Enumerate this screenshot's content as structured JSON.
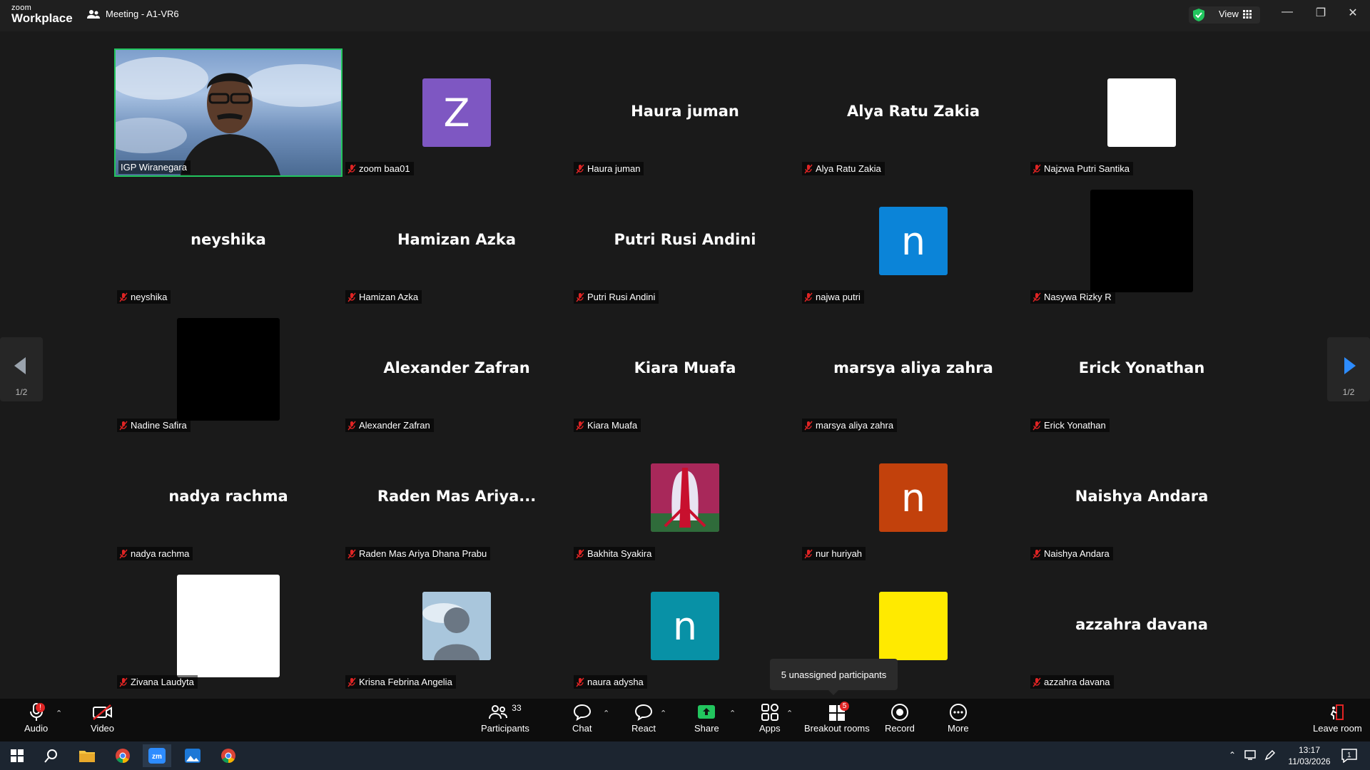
{
  "titlebar": {
    "logo_line1": "zoom",
    "logo_line2": "Workplace",
    "meeting_title": "Meeting - A1-VR6",
    "view_label": "View"
  },
  "colors": {
    "active_speaker_border": "#22c55e",
    "avatar_purple": "#7e57c2",
    "avatar_blue": "#0b84d8",
    "avatar_orange": "#c2410c",
    "avatar_teal": "#0891a6",
    "avatar_yellow": "#ffea00",
    "share_green": "#22c55e"
  },
  "participants": [
    {
      "label": "IGP Wiranegara",
      "type": "video"
    },
    {
      "label": "zoom baa01",
      "type": "avatar",
      "letter": "Z",
      "color": "#7e57c2"
    },
    {
      "label": "Haura juman",
      "type": "name",
      "display": "Haura juman"
    },
    {
      "label": "Alya Ratu Zakia",
      "type": "name",
      "display": "Alya Ratu Zakia"
    },
    {
      "label": "Najzwa Putri Santika",
      "type": "avatar",
      "letter": "",
      "color": "#ffffff"
    },
    {
      "label": "neyshika",
      "type": "name",
      "display": "neyshika"
    },
    {
      "label": "Hamizan Azka",
      "type": "name",
      "display": "Hamizan Azka"
    },
    {
      "label": "Putri Rusi Andini",
      "type": "name",
      "display": "Putri Rusi Andini"
    },
    {
      "label": "najwa putri",
      "type": "avatar",
      "letter": "n",
      "color": "#0b84d8"
    },
    {
      "label": "Nasywa Rizky R",
      "type": "bigbox",
      "color": "#000000"
    },
    {
      "label": "Nadine Safira",
      "type": "bigbox",
      "color": "#000000"
    },
    {
      "label": "Alexander Zafran",
      "type": "name",
      "display": "Alexander Zafran"
    },
    {
      "label": "Kiara Muafa",
      "type": "name",
      "display": "Kiara Muafa"
    },
    {
      "label": "marsya aliya zahra",
      "type": "name",
      "display": "marsya aliya zahra"
    },
    {
      "label": "Erick Yonathan",
      "type": "name",
      "display": "Erick Yonathan"
    },
    {
      "label": "nadya rachma",
      "type": "name",
      "display": "nadya rachma"
    },
    {
      "label": "Raden Mas Ariya Dhana Prabu",
      "type": "name",
      "display": "Raden Mas Ariya..."
    },
    {
      "label": "Bakhita Syakira",
      "type": "picture",
      "color": "#b0285e"
    },
    {
      "label": "nur huriyah",
      "type": "avatar",
      "letter": "n",
      "color": "#c2410c"
    },
    {
      "label": "Naishya Andara",
      "type": "name",
      "display": "Naishya Andara"
    },
    {
      "label": "Zivana Laudyta",
      "type": "bigbox",
      "color": "#ffffff"
    },
    {
      "label": "Krisna Febrina Angelia",
      "type": "person",
      "color": "#a9c6dc"
    },
    {
      "label": "naura adysha",
      "type": "avatar",
      "letter": "n",
      "color": "#0891a6"
    },
    {
      "label": "",
      "type": "avatar",
      "letter": "",
      "color": "#ffea00"
    },
    {
      "label": "azzahra davana",
      "type": "name",
      "display": "azzahra davana"
    }
  ],
  "pager": {
    "left": "1/2",
    "right": "1/2"
  },
  "tooltip": "5 unassigned participants",
  "toolbar": {
    "audio": "Audio",
    "video": "Video",
    "participants": "Participants",
    "participants_count": "33",
    "chat": "Chat",
    "react": "React",
    "share": "Share",
    "apps": "Apps",
    "breakout": "Breakout rooms",
    "breakout_badge": "5",
    "record": "Record",
    "more": "More",
    "leave": "Leave room",
    "audio_badge": "!"
  },
  "taskbar": {
    "time": "13:17",
    "date": "11/03/2026",
    "notif_count": "1"
  }
}
